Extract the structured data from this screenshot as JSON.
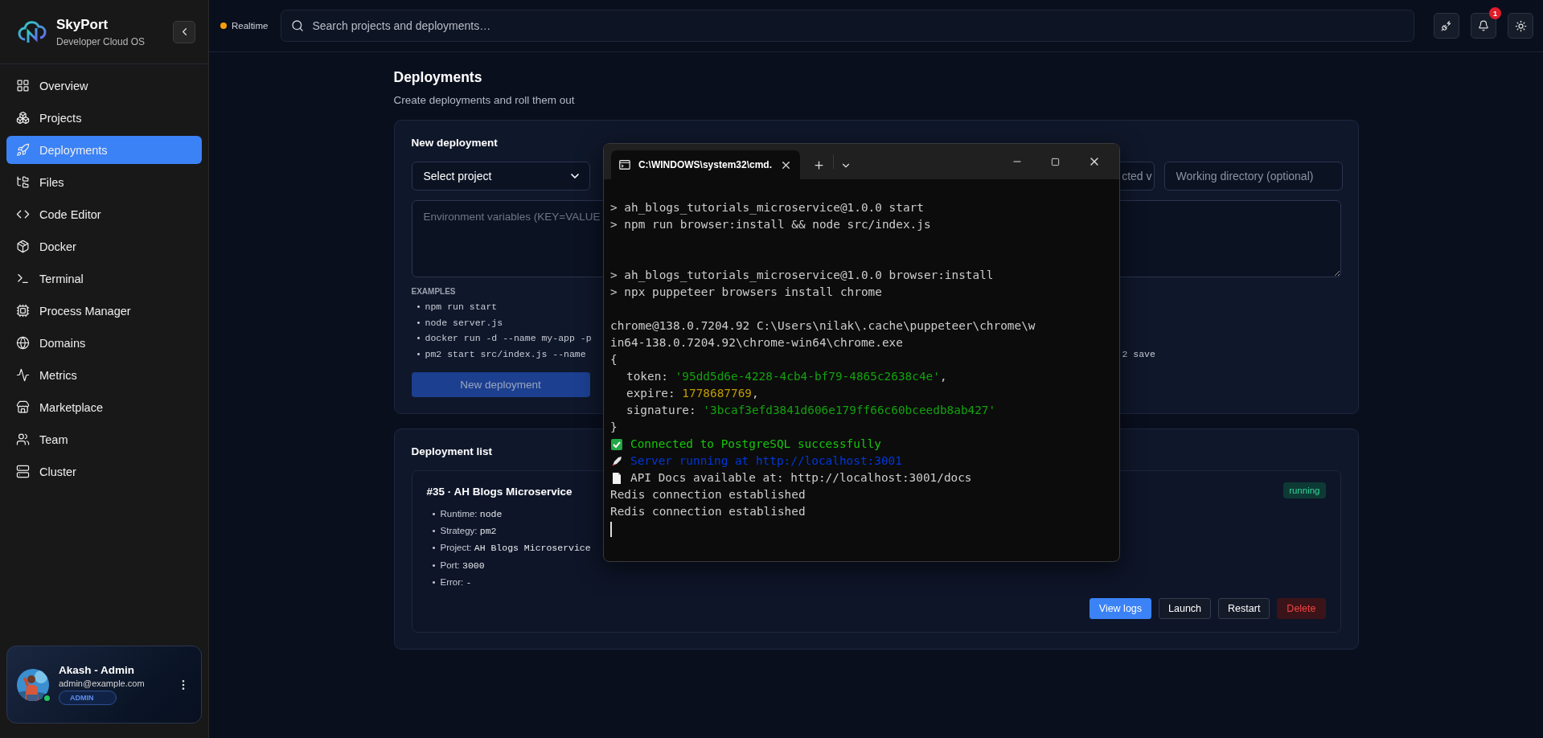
{
  "sidebar": {
    "brand": {
      "name": "SkyPort",
      "tagline": "Developer Cloud OS"
    },
    "items": [
      {
        "label": "Overview",
        "selected": false
      },
      {
        "label": "Projects",
        "selected": false
      },
      {
        "label": "Deployments",
        "selected": true
      },
      {
        "label": "Files",
        "selected": false
      },
      {
        "label": "Code Editor",
        "selected": false
      },
      {
        "label": "Docker",
        "selected": false
      },
      {
        "label": "Terminal",
        "selected": false
      },
      {
        "label": "Process Manager",
        "selected": false
      },
      {
        "label": "Domains",
        "selected": false
      },
      {
        "label": "Metrics",
        "selected": false
      },
      {
        "label": "Marketplace",
        "selected": false
      },
      {
        "label": "Team",
        "selected": false
      },
      {
        "label": "Cluster",
        "selected": false
      }
    ],
    "user": {
      "name": "Akash - Admin",
      "email": "admin@example.com",
      "role": "ADMIN",
      "online": true
    }
  },
  "topbar": {
    "status": {
      "label": "Realtime",
      "color": "#f59e0b"
    },
    "search": {
      "placeholder": "Search projects and deployments…"
    },
    "notifications": "1"
  },
  "page": {
    "title": "Deployments",
    "subtitle": "Create deployments and roll them out"
  },
  "new_deployment": {
    "title": "New deployment",
    "project_select": {
      "value": "Select project"
    },
    "field_4": {
      "value": "cted v"
    },
    "workdir": {
      "placeholder": "Working directory (optional)"
    },
    "env": {
      "placeholder": "Environment variables (KEY=VALUE"
    },
    "examples_title": "EXAMPLES",
    "examples": [
      {
        "bullet": "•",
        "text": "npm run start"
      },
      {
        "bullet": "•",
        "text": "node server.js"
      },
      {
        "bullet": "•",
        "text": "docker run -d --name my-app -p"
      },
      {
        "bullet": "•",
        "text": "pm2 start src/index.js --name",
        "tail": "2 save"
      }
    ],
    "button": {
      "label": "New deployment",
      "disabled": true
    }
  },
  "deployment_list": {
    "title": "Deployment list",
    "items": [
      {
        "title": "#35 · AH Blogs Microservice",
        "status": "running",
        "props": [
          {
            "bullet": "•",
            "label": "Runtime:",
            "value": "node"
          },
          {
            "bullet": "•",
            "label": "Strategy:",
            "value": "pm2"
          },
          {
            "bullet": "•",
            "label": "Project:",
            "value": "AH Blogs Microservice"
          },
          {
            "bullet": "•",
            "label": "Port:",
            "value": "3000"
          },
          {
            "bullet": "•",
            "label": "Error:",
            "value": "-"
          }
        ],
        "actions": [
          {
            "label": "View logs",
            "kind": "primary"
          },
          {
            "label": "Launch",
            "kind": "default"
          },
          {
            "label": "Restart",
            "kind": "default"
          },
          {
            "label": "Delete",
            "kind": "danger"
          }
        ]
      }
    ]
  },
  "terminal": {
    "tab_title": "C:\\WINDOWS\\system32\\cmd.",
    "lines": [
      {
        "kind": "blank"
      },
      {
        "kind": "text",
        "segments": [
          {
            "text": "> ah_blogs_tutorials_microservice@1.0.0 start",
            "kind": "plain"
          }
        ]
      },
      {
        "kind": "text",
        "segments": [
          {
            "text": "> npm run browser:install && node src/index.js",
            "kind": "plain"
          }
        ]
      },
      {
        "kind": "blank"
      },
      {
        "kind": "blank"
      },
      {
        "kind": "text",
        "segments": [
          {
            "text": "> ah_blogs_tutorials_microservice@1.0.0 browser:install",
            "kind": "plain"
          }
        ]
      },
      {
        "kind": "text",
        "segments": [
          {
            "text": "> npx puppeteer browsers install chrome",
            "kind": "plain"
          }
        ]
      },
      {
        "kind": "blank"
      },
      {
        "kind": "text",
        "segments": [
          {
            "text": "chrome@138.0.7204.92 C:\\Users\\nilak\\.cache\\puppeteer\\chrome\\w",
            "kind": "plain"
          }
        ]
      },
      {
        "kind": "text",
        "segments": [
          {
            "text": "in64-138.0.7204.92\\chrome-win64\\chrome.exe",
            "kind": "plain"
          }
        ]
      },
      {
        "kind": "text",
        "segments": [
          {
            "text": "{",
            "kind": "plain"
          }
        ]
      },
      {
        "kind": "property",
        "segments": [
          {
            "text": "token:",
            "kind": "plain"
          },
          {
            "text": "'95dd5d6e-4228-4cb4-bf79-4865c2638c4e'",
            "kind": "string"
          },
          {
            "text": ",",
            "kind": "plain"
          }
        ]
      },
      {
        "kind": "property",
        "segments": [
          {
            "text": "expire:",
            "kind": "plain"
          },
          {
            "text": "1778687769",
            "kind": "number"
          },
          {
            "text": ",",
            "kind": "plain"
          }
        ]
      },
      {
        "kind": "property",
        "segments": [
          {
            "text": "signature:",
            "kind": "plain"
          },
          {
            "text": "'3bcaf3efd3841d606e179ff66c60bceedb8ab427'",
            "kind": "string"
          }
        ]
      },
      {
        "kind": "text",
        "segments": [
          {
            "text": "}",
            "kind": "plain"
          }
        ]
      },
      {
        "kind": "success",
        "segments": [
          {
            "text": "Connected to PostgreSQL successfully",
            "kind": "success"
          }
        ]
      },
      {
        "kind": "launch",
        "segments": [
          {
            "text": "Server running at http://localhost:3001",
            "kind": "link"
          }
        ]
      },
      {
        "kind": "docs",
        "segments": [
          {
            "text": "API Docs available at: http://localhost:3001/docs",
            "kind": "plain"
          }
        ]
      },
      {
        "kind": "text",
        "segments": [
          {
            "text": "Redis connection established",
            "kind": "plain"
          }
        ]
      },
      {
        "kind": "text",
        "segments": [
          {
            "text": "Redis connection established",
            "kind": "plain"
          }
        ]
      }
    ]
  }
}
